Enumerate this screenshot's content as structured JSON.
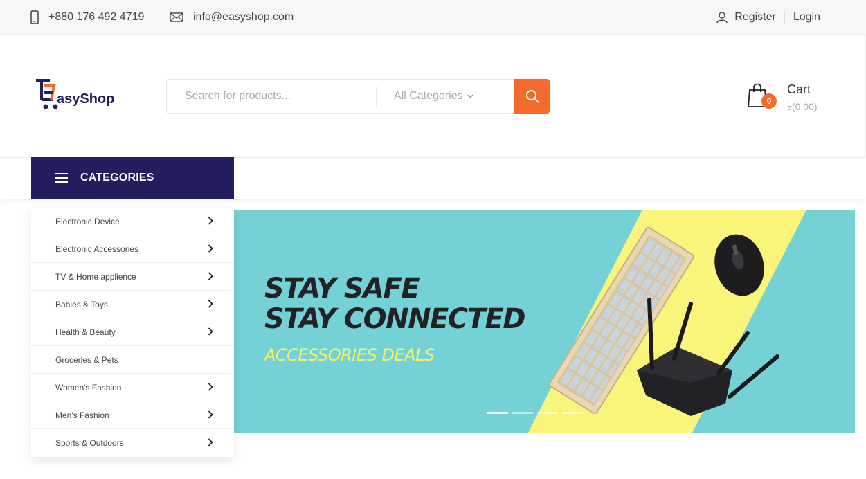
{
  "topbar": {
    "phone": "+880 176 492 4719",
    "email": "info@easyshop.com",
    "register": "Register",
    "login": "Login"
  },
  "logo": {
    "text": "asyShop",
    "colors": {
      "brand": "#231f5f",
      "accent": "#f26b2a"
    }
  },
  "search": {
    "placeholder": "Search for products...",
    "category": "All Categories"
  },
  "cart": {
    "label": "Cart",
    "count": "0",
    "total": "৳(0.00)"
  },
  "nav": {
    "categories_label": "CATEGORIES"
  },
  "categories": [
    {
      "label": "Electronic Device",
      "has_sub": true
    },
    {
      "label": "Electronic Accessories",
      "has_sub": true
    },
    {
      "label": "TV & Home applience",
      "has_sub": true
    },
    {
      "label": "Babies & Toys",
      "has_sub": true
    },
    {
      "label": "Health & Beauty",
      "has_sub": true
    },
    {
      "label": "Groceries & Pets",
      "has_sub": false
    },
    {
      "label": "Women's Fashion",
      "has_sub": true
    },
    {
      "label": "Men's Fashion",
      "has_sub": true
    },
    {
      "label": "Sports & Outdoors",
      "has_sub": true
    }
  ],
  "banner": {
    "line1": "STAY SAFE",
    "line2": "STAY CONNECTED",
    "line3": "ACCESSORIES DEALS",
    "slides": 4,
    "active_slide": 1
  },
  "colors": {
    "accent": "#f26b2a",
    "nav": "#231f5f",
    "banner_bg": "#74d1d6",
    "banner_stripe": "#f8f57a"
  },
  "icons": [
    "phone-icon",
    "mail-icon",
    "user-icon",
    "search-icon",
    "chevron-down-icon",
    "shopping-bag-icon",
    "menu-icon",
    "chevron-right-icon"
  ]
}
